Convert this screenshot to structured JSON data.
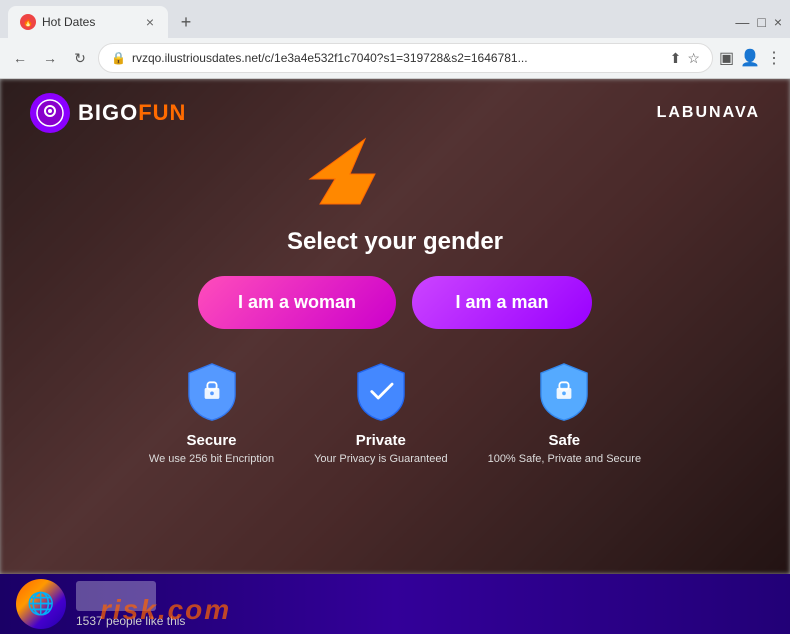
{
  "browser": {
    "tab": {
      "favicon": "🔥",
      "title": "Hot Dates",
      "close_label": "×",
      "new_tab_label": "+"
    },
    "window_controls": {
      "minimize": "—",
      "maximize": "□",
      "close": "×"
    },
    "address": {
      "url": "rvzqo.ilustriousdates.net/c/1e3a4e532f1c7040?s1=319728&s2=1646781...",
      "lock_icon": "🔒"
    },
    "nav": {
      "back": "←",
      "forward": "→",
      "refresh": "↻"
    }
  },
  "site": {
    "logo": {
      "icon": "◎",
      "bigo": "BIGO",
      "fun": "FUN"
    },
    "nav_label": "LABUNAVA",
    "heading": "Select your gender",
    "woman_button": "I am a woman",
    "man_button": "I am a man",
    "badges": [
      {
        "title": "Secure",
        "desc": "We use 256 bit Encription",
        "color": "#4488ff"
      },
      {
        "title": "Private",
        "desc": "Your Privacy is Guaranteed",
        "color": "#4488ff"
      },
      {
        "title": "Safe",
        "desc": "100% Safe, Private and Secure",
        "color": "#4488ff"
      }
    ],
    "bottom": {
      "likes_text": "1537 people like this",
      "watermark": "risk.com"
    }
  }
}
